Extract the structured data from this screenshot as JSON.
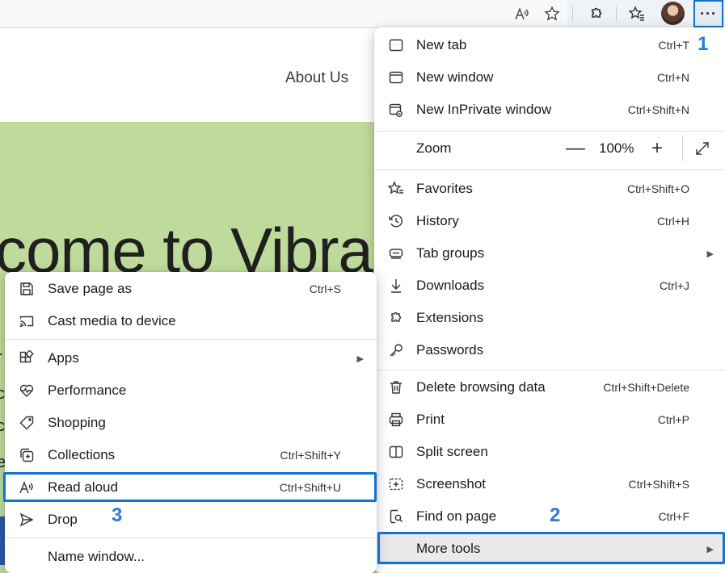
{
  "toolbar": {
    "icons": [
      "read-aloud-icon",
      "favorite-star-icon",
      "extensions-icon",
      "favorites-icon",
      "profile-avatar",
      "more-icon"
    ],
    "more_label": "···"
  },
  "page": {
    "nav_about": "About Us",
    "hero_title": "come to Vibrar",
    "fragments": [
      "r",
      "c",
      "c",
      "e"
    ]
  },
  "main_menu": {
    "items": [
      {
        "label": "New tab",
        "shortcut": "Ctrl+T",
        "icon": "new-tab-icon"
      },
      {
        "label": "New window",
        "shortcut": "Ctrl+N",
        "icon": "new-window-icon"
      },
      {
        "label": "New InPrivate window",
        "shortcut": "Ctrl+Shift+N",
        "icon": "inprivate-icon"
      },
      {
        "label": "Zoom",
        "zoom_minus": "—",
        "zoom_value": "100%",
        "zoom_plus": "+",
        "icon": "fullscreen-icon"
      },
      {
        "label": "Favorites",
        "shortcut": "Ctrl+Shift+O",
        "icon": "favorites-icon"
      },
      {
        "label": "History",
        "shortcut": "Ctrl+H",
        "icon": "history-icon"
      },
      {
        "label": "Tab groups",
        "shortcut": "",
        "icon": "tab-groups-icon"
      },
      {
        "label": "Downloads",
        "shortcut": "Ctrl+J",
        "icon": "download-icon"
      },
      {
        "label": "Extensions",
        "shortcut": "",
        "icon": "extensions-icon"
      },
      {
        "label": "Passwords",
        "shortcut": "",
        "icon": "key-icon"
      },
      {
        "label": "Delete browsing data",
        "shortcut": "Ctrl+Shift+Delete",
        "icon": "trash-icon"
      },
      {
        "label": "Print",
        "shortcut": "Ctrl+P",
        "icon": "print-icon"
      },
      {
        "label": "Split screen",
        "shortcut": "",
        "icon": "split-screen-icon"
      },
      {
        "label": "Screenshot",
        "shortcut": "Ctrl+Shift+S",
        "icon": "screenshot-icon"
      },
      {
        "label": "Find on page",
        "shortcut": "Ctrl+F",
        "icon": "find-icon"
      },
      {
        "label": "More tools",
        "shortcut": "",
        "icon": ""
      }
    ]
  },
  "sub_menu": {
    "items": [
      {
        "label": "Save page as",
        "shortcut": "Ctrl+S",
        "icon": "save-icon"
      },
      {
        "label": "Cast media to device",
        "shortcut": "",
        "icon": "cast-icon"
      },
      {
        "label": "Apps",
        "shortcut": "",
        "icon": "apps-icon"
      },
      {
        "label": "Performance",
        "shortcut": "",
        "icon": "performance-icon"
      },
      {
        "label": "Shopping",
        "shortcut": "",
        "icon": "shopping-tag-icon"
      },
      {
        "label": "Collections",
        "shortcut": "Ctrl+Shift+Y",
        "icon": "collections-icon"
      },
      {
        "label": "Read aloud",
        "shortcut": "Ctrl+Shift+U",
        "icon": "read-aloud-icon"
      },
      {
        "label": "Drop",
        "shortcut": "",
        "icon": "drop-send-icon"
      },
      {
        "label": "Name window...",
        "shortcut": "",
        "icon": ""
      }
    ]
  },
  "annotations": {
    "step1": "1",
    "step2": "2",
    "step3": "3",
    "highlight_color": "#0f73cf",
    "step_color": "#2b7ad6"
  }
}
